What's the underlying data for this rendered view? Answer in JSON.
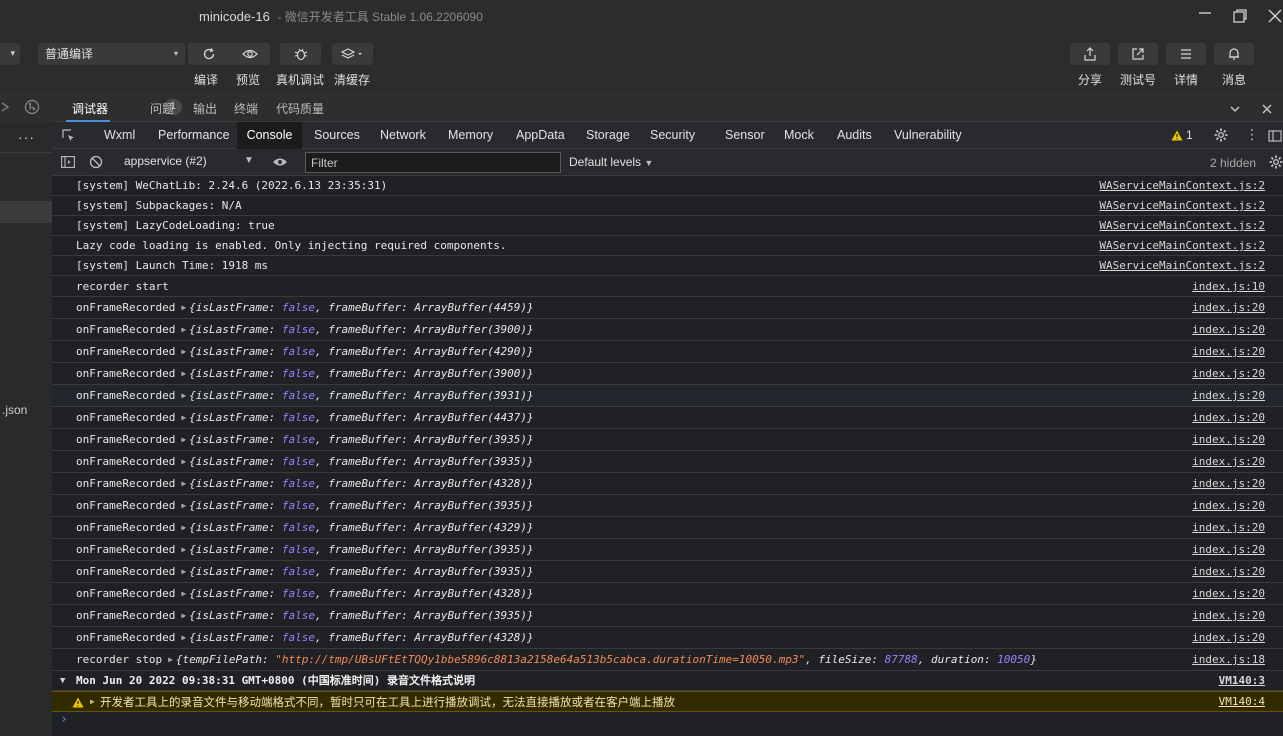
{
  "window": {
    "title": "minicode-16",
    "subtitle": "- 微信开发者工具 Stable 1.06.2206090"
  },
  "toolbar": {
    "compile_mode": "普通编译",
    "compile_label": "编译",
    "preview_label": "预览",
    "remote_debug_label": "真机调试",
    "clear_cache_label": "清缓存",
    "share_label": "分享",
    "test_account_label": "测试号",
    "details_label": "详情",
    "messages_label": "消息"
  },
  "sidebar": {
    "dots": "···",
    "file_fragment": ".json"
  },
  "devtools_tabs": {
    "debugger": "调试器",
    "debugger_badge": "1",
    "issues": "问题",
    "output": "输出",
    "terminal": "终端",
    "code_quality": "代码质量"
  },
  "panel_tabs": [
    "Wxml",
    "Performance",
    "Console",
    "Sources",
    "Network",
    "Memory",
    "AppData",
    "Storage",
    "Security",
    "Sensor",
    "Mock",
    "Audits",
    "Vulnerability"
  ],
  "warning_count": "1",
  "filter_bar": {
    "context": "appservice (#2)",
    "filter_placeholder": "Filter",
    "levels": "Default levels",
    "hidden": "2 hidden"
  },
  "logs": {
    "system": [
      {
        "text": "[system] WeChatLib: 2.24.6 (2022.6.13 23:35:31)",
        "src": "WAServiceMainContext.js:2"
      },
      {
        "text": "[system] Subpackages: N/A",
        "src": "WAServiceMainContext.js:2"
      },
      {
        "text": "[system] LazyCodeLoading: true",
        "src": "WAServiceMainContext.js:2"
      },
      {
        "text": "Lazy code loading is enabled. Only injecting required components.",
        "src": "WAServiceMainContext.js:2"
      },
      {
        "text": "[system] Launch Time: 1918 ms",
        "src": "WAServiceMainContext.js:2"
      },
      {
        "text": "recorder start",
        "src": "index.js:10"
      }
    ],
    "frame_label": "onFrameRecorded",
    "frame_key1": "isLastFrame",
    "frame_val1": "false",
    "frame_key2": "frameBuffer",
    "frame_src": "index.js:20",
    "frames": [
      {
        "buffer": "ArrayBuffer(4459)"
      },
      {
        "buffer": "ArrayBuffer(3900)"
      },
      {
        "buffer": "ArrayBuffer(4290)"
      },
      {
        "buffer": "ArrayBuffer(3900)"
      },
      {
        "buffer": "ArrayBuffer(3931)"
      },
      {
        "buffer": "ArrayBuffer(4437)"
      },
      {
        "buffer": "ArrayBuffer(3935)"
      },
      {
        "buffer": "ArrayBuffer(3935)"
      },
      {
        "buffer": "ArrayBuffer(4328)"
      },
      {
        "buffer": "ArrayBuffer(3935)"
      },
      {
        "buffer": "ArrayBuffer(4329)"
      },
      {
        "buffer": "ArrayBuffer(3935)"
      },
      {
        "buffer": "ArrayBuffer(3935)"
      },
      {
        "buffer": "ArrayBuffer(4328)"
      },
      {
        "buffer": "ArrayBuffer(3935)"
      },
      {
        "buffer": "ArrayBuffer(4328)"
      }
    ],
    "stop": {
      "label": "recorder stop",
      "key1": "tempFilePath",
      "path": "\"http://tmp/UBsUFtEtTQQy1bbe5896c8813a2158e64a513b5cabca.durationTime=10050.mp3\"",
      "key2": "fileSize",
      "size": "87788",
      "key3": "duration",
      "duration": "10050",
      "src": "index.js:18"
    },
    "group": {
      "text": "Mon Jun 20 2022 09:38:31 GMT+0800 (中国标准时间) 录音文件格式说明",
      "src": "VM140:3"
    },
    "warning": {
      "text": "开发者工具上的录音文件与移动端格式不同，暂时只可在工具上进行播放调试，无法直接播放或者在客户端上播放",
      "src": "VM140:4"
    },
    "prompt": "›"
  },
  "colors": {
    "accent": "#4a90e2",
    "warning_bg": "#332b00",
    "warning_icon": "#f2c300",
    "keyword": "#9980ff",
    "string": "#f28b54"
  }
}
